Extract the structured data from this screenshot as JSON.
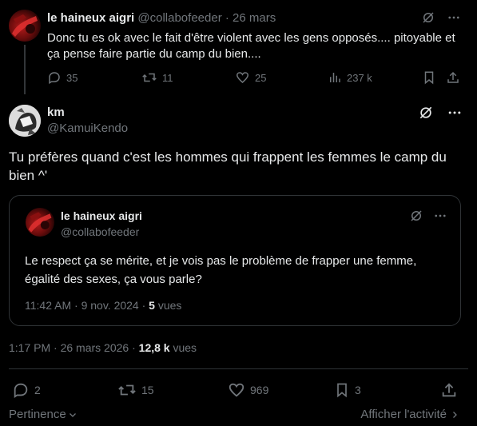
{
  "reply": {
    "author_name": "le haineux aigri",
    "handle": "@collabofeeder",
    "separator": "·",
    "date": "26 mars",
    "text": "Donc tu es ok avec le fait d'être violent avec les gens opposés.... pitoyable et ça pense faire partie du camp du bien....",
    "stats": {
      "replies": "35",
      "reposts": "11",
      "likes": "25",
      "views": "237 k"
    }
  },
  "main": {
    "author_name": "km",
    "handle": "@KamuiKendo",
    "text": "Tu préfères quand c'est les hommes qui frappent les femmes le camp du bien ^'",
    "time": "1:17 PM",
    "separator1": "·",
    "date": "26 mars 2026",
    "separator2": "·",
    "views_count": "12,8 k",
    "views_label": "vues",
    "stats": {
      "replies": "2",
      "reposts": "15",
      "likes": "969",
      "bookmarks": "3"
    }
  },
  "quote": {
    "author_name": "le haineux aigri",
    "handle": "@collabofeeder",
    "text": "Le respect ça se mérite, et je vois pas le problème de frapper une femme, égalité des sexes, ça vous parle?",
    "time": "11:42 AM",
    "separator1": "·",
    "date": "9 nov. 2024",
    "separator2": "·",
    "views_count": "5",
    "views_label": "vues"
  },
  "footer": {
    "sort_label": "Pertinence",
    "activity_label": "Afficher l'activité"
  },
  "icons": [
    "grok-slash-icon",
    "more-icon",
    "reply-icon",
    "repost-icon",
    "like-icon",
    "views-icon",
    "bookmark-icon",
    "share-icon",
    "chevron-down-icon",
    "chevron-right-icon"
  ],
  "colors": {
    "background": "#000000",
    "text": "#e7e9ea",
    "muted": "#71767b",
    "border": "#2f3336"
  }
}
